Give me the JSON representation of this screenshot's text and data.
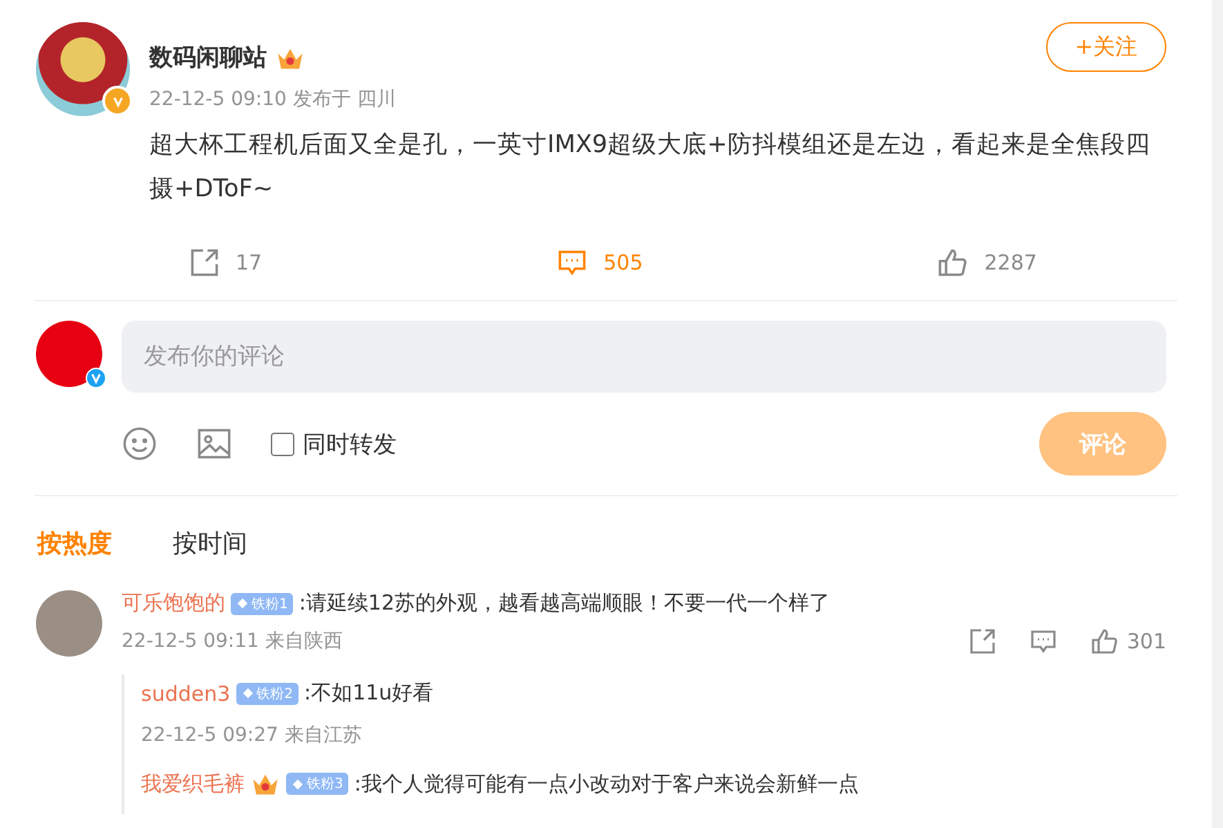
{
  "post": {
    "author": {
      "name": "数码闲聊站",
      "crown": true,
      "verified": true
    },
    "time": "22-12-5 09:10",
    "location": "发布于 四川",
    "text": "超大杯工程机后面又全是孔，一英寸IMX9超级大底+防抖模组还是左边，看起来是全焦段四摄+DToF~",
    "follow_button": "+关注",
    "actions": [
      {
        "kind": "repost",
        "count": "17",
        "selected": false
      },
      {
        "kind": "comment",
        "count": "505",
        "selected": true
      },
      {
        "kind": "like",
        "count": "2287",
        "selected": false
      }
    ]
  },
  "composer": {
    "verified": true,
    "placeholder": "发布你的评论",
    "also_repost": {
      "label": "同时转发",
      "checked": false
    },
    "submit": {
      "label": "评论",
      "disabled": true
    }
  },
  "sort_tabs": [
    {
      "label": "按热度",
      "selected": true
    },
    {
      "label": "按时间",
      "selected": false
    }
  ],
  "comments": [
    {
      "name": "可乐饱饱的",
      "crown": false,
      "badge": "铁粉1",
      "text": ":请延续12苏的外观，越看越高端顺眼！不要一代一个样了",
      "time": "22-12-5 09:11 来自陕西",
      "likes": "301",
      "replies": [
        {
          "name": "sudden3",
          "crown": false,
          "badge": "铁粉2",
          "text": ":不如11u好看",
          "time": "22-12-5 09:27 来自江苏"
        },
        {
          "name": "我爱织毛裤",
          "crown": true,
          "badge": "铁粉3",
          "text": ":我个人觉得可能有一点小改动对于客户来说会新鲜一点"
        }
      ]
    }
  ]
}
